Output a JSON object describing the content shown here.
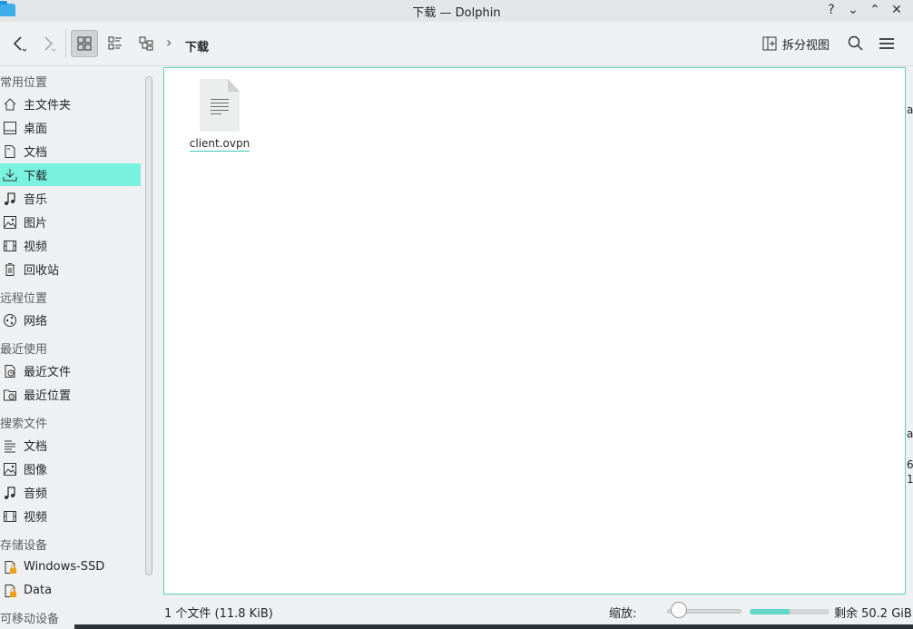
{
  "window": {
    "title": "下载 — Dolphin",
    "controls": [
      "?",
      "⌄",
      "⌃",
      "✕"
    ]
  },
  "toolbar": {
    "back_icon": "chevron-left-icon",
    "forward_icon": "chevron-right-icon",
    "breadcrumb": {
      "current": "下载"
    },
    "split_view_label": "拆分视图"
  },
  "sidebar": {
    "sections": [
      {
        "title": "常用位置",
        "items": [
          "主文件夹",
          "桌面",
          "文档",
          "下载",
          "音乐",
          "图片",
          "视频",
          "回收站"
        ]
      },
      {
        "title": "远程位置",
        "items": [
          "网络"
        ]
      },
      {
        "title": "最近使用",
        "items": [
          "最近文件",
          "最近位置"
        ]
      },
      {
        "title": "搜索文件",
        "items": [
          "文档",
          "图像",
          "音频",
          "视频"
        ]
      },
      {
        "title": "存储设备",
        "items": [
          "Windows-SSD",
          "Data"
        ]
      },
      {
        "title": "可移动设备",
        "items": []
      }
    ],
    "active_item": "下载"
  },
  "files": [
    {
      "name": "client.ovpn",
      "icon": "text-file-icon"
    }
  ],
  "status": {
    "count": "1 个文件 (11.8 KiB)",
    "zoom_label": "缩放:",
    "zoom_level": 0.05,
    "free_label": "剩余 50.2 GiB",
    "free_fraction": 0.5
  },
  "background_text": [
    "a",
    "a",
    "6",
    "1"
  ],
  "colors": {
    "accent": "#79f3df",
    "focus_border": "#5ccfbf"
  }
}
